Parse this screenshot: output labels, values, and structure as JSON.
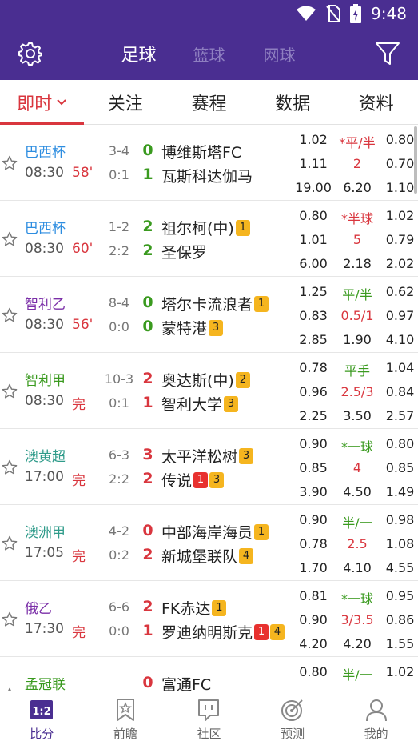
{
  "status": {
    "time": "9:48"
  },
  "header": {
    "tabs": [
      "足球",
      "篮球",
      "网球"
    ],
    "active_tab": 0
  },
  "subnav": {
    "items": [
      "即时",
      "关注",
      "赛程",
      "数据",
      "资料"
    ]
  },
  "colors": {
    "brand": "#4a2e91",
    "accent": "#d9363e",
    "yellow_card": "#f5b51f",
    "red_card": "#e8312f"
  },
  "matches": [
    {
      "league": "巴西杯",
      "league_color": "#2d8de0",
      "time": "08:30",
      "minute": "58'",
      "corner1": "3-4",
      "corner2": "0:1",
      "home": "博维斯塔FC",
      "away": "瓦斯科达伽马",
      "home_score": "0",
      "away_score": "1",
      "home_score_color": "#3a9a1f",
      "away_score_color": "#3a9a1f",
      "home_badges": [],
      "away_badges": [],
      "odds": [
        [
          "1.02",
          "*平/半",
          "0.80"
        ],
        [
          "1.11",
          "2",
          "0.70"
        ],
        [
          "19.00",
          "6.20",
          "1.10"
        ]
      ],
      "mid_colors": [
        "#d9363e",
        "#d9363e"
      ]
    },
    {
      "league": "巴西杯",
      "league_color": "#2d8de0",
      "time": "08:30",
      "minute": "60'",
      "corner1": "1-2",
      "corner2": "2:2",
      "home": "祖尔柯(中)",
      "away": "圣保罗",
      "home_score": "2",
      "away_score": "2",
      "home_score_color": "#3a9a1f",
      "away_score_color": "#3a9a1f",
      "home_badges": [
        {
          "t": "1",
          "c": "y"
        }
      ],
      "away_badges": [],
      "odds": [
        [
          "0.80",
          "*半球",
          "1.02"
        ],
        [
          "1.01",
          "5",
          "0.79"
        ],
        [
          "6.00",
          "2.18",
          "2.02"
        ]
      ],
      "mid_colors": [
        "#d9363e",
        "#d9363e"
      ]
    },
    {
      "league": "智利乙",
      "league_color": "#7b2fa8",
      "time": "08:30",
      "minute": "56'",
      "corner1": "8-4",
      "corner2": "0:0",
      "home": "塔尔卡流浪者",
      "away": "蒙特港",
      "home_score": "0",
      "away_score": "0",
      "home_score_color": "#3a9a1f",
      "away_score_color": "#3a9a1f",
      "home_badges": [
        {
          "t": "1",
          "c": "y"
        }
      ],
      "away_badges": [
        {
          "t": "3",
          "c": "y"
        }
      ],
      "odds": [
        [
          "1.25",
          "平/半",
          "0.62"
        ],
        [
          "0.83",
          "0.5/1",
          "0.97"
        ],
        [
          "2.85",
          "1.90",
          "4.10"
        ]
      ],
      "mid_colors": [
        "#3a9a1f",
        "#d9363e"
      ]
    },
    {
      "league": "智利甲",
      "league_color": "#3a9a1f",
      "time": "08:30",
      "minute": "完",
      "corner1": "10-3",
      "corner2": "0:1",
      "home": "奥达斯(中)",
      "away": "智利大学",
      "home_score": "2",
      "away_score": "1",
      "home_score_color": "#d9363e",
      "away_score_color": "#d9363e",
      "home_badges": [
        {
          "t": "2",
          "c": "y"
        }
      ],
      "away_badges": [
        {
          "t": "3",
          "c": "y"
        }
      ],
      "odds": [
        [
          "0.78",
          "平手",
          "1.04"
        ],
        [
          "0.96",
          "2.5/3",
          "0.84"
        ],
        [
          "2.25",
          "3.50",
          "2.57"
        ]
      ],
      "mid_colors": [
        "#3a9a1f",
        "#d9363e"
      ]
    },
    {
      "league": "澳黄超",
      "league_color": "#2f9b8a",
      "time": "17:00",
      "minute": "完",
      "corner1": "6-3",
      "corner2": "2:2",
      "home": "太平洋松树",
      "away": "传说",
      "home_score": "3",
      "away_score": "2",
      "home_score_color": "#d9363e",
      "away_score_color": "#d9363e",
      "home_badges": [
        {
          "t": "3",
          "c": "y"
        }
      ],
      "away_badges": [
        {
          "t": "1",
          "c": "r"
        },
        {
          "t": "3",
          "c": "y"
        }
      ],
      "odds": [
        [
          "0.90",
          "*一球",
          "0.80"
        ],
        [
          "0.85",
          "4",
          "0.85"
        ],
        [
          "3.90",
          "4.50",
          "1.49"
        ]
      ],
      "mid_colors": [
        "#3a9a1f",
        "#d9363e"
      ]
    },
    {
      "league": "澳洲甲",
      "league_color": "#2f9b8a",
      "time": "17:05",
      "minute": "完",
      "corner1": "4-2",
      "corner2": "0:2",
      "home": "中部海岸海员",
      "away": "新城堡联队",
      "home_score": "0",
      "away_score": "2",
      "home_score_color": "#d9363e",
      "away_score_color": "#d9363e",
      "home_badges": [
        {
          "t": "1",
          "c": "y"
        }
      ],
      "away_badges": [
        {
          "t": "4",
          "c": "y"
        }
      ],
      "odds": [
        [
          "0.90",
          "半/一",
          "0.98"
        ],
        [
          "0.78",
          "2.5",
          "1.08"
        ],
        [
          "1.70",
          "4.10",
          "4.55"
        ]
      ],
      "mid_colors": [
        "#3a9a1f",
        "#d9363e"
      ]
    },
    {
      "league": "俄乙",
      "league_color": "#7b2fa8",
      "time": "17:30",
      "minute": "完",
      "corner1": "6-6",
      "corner2": "0:0",
      "home": "FK赤达",
      "away": "罗迪纳明斯克",
      "home_score": "2",
      "away_score": "1",
      "home_score_color": "#d9363e",
      "away_score_color": "#d9363e",
      "home_badges": [
        {
          "t": "1",
          "c": "y"
        }
      ],
      "away_badges": [
        {
          "t": "1",
          "c": "r"
        },
        {
          "t": "4",
          "c": "y"
        }
      ],
      "odds": [
        [
          "0.81",
          "*一球",
          "0.95"
        ],
        [
          "0.90",
          "3/3.5",
          "0.86"
        ],
        [
          "4.20",
          "4.20",
          "1.55"
        ]
      ],
      "mid_colors": [
        "#3a9a1f",
        "#d9363e"
      ]
    },
    {
      "league": "孟冠联",
      "league_color": "#3a9a1f",
      "time": "",
      "minute": "",
      "corner1": "",
      "corner2": "",
      "home": "富通FC",
      "away": "",
      "home_score": "0",
      "away_score": "",
      "home_score_color": "#d9363e",
      "away_score_color": "#d9363e",
      "home_badges": [],
      "away_badges": [],
      "odds": [
        [
          "0.80",
          "半/一",
          "1.02"
        ],
        [
          "",
          "",
          ""
        ],
        [
          "",
          "",
          ""
        ]
      ],
      "mid_colors": [
        "#3a9a1f",
        "#d9363e"
      ]
    }
  ],
  "bottomnav": {
    "items": [
      "比分",
      "前瞻",
      "社区",
      "预测",
      "我的"
    ],
    "active": 0,
    "score_icon_text": "1:2"
  }
}
